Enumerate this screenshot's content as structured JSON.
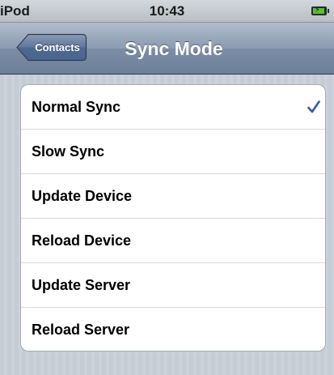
{
  "status_bar": {
    "carrier": "iPod",
    "time": "10:43",
    "battery_icon": "battery-charging-icon"
  },
  "nav_bar": {
    "back_label": "Contacts",
    "title": "Sync Mode"
  },
  "sync_modes": {
    "items": [
      {
        "label": "Normal Sync",
        "selected": true
      },
      {
        "label": "Slow Sync",
        "selected": false
      },
      {
        "label": "Update Device",
        "selected": false
      },
      {
        "label": "Reload Device",
        "selected": false
      },
      {
        "label": "Update Server",
        "selected": false
      },
      {
        "label": "Reload Server",
        "selected": false
      }
    ],
    "check_icon": "checkmark-icon"
  },
  "colors": {
    "nav_bar": "#6d7f99",
    "checkmark": "#3b5998",
    "battery_charge": "#55c233",
    "background": "#c5ccd4"
  }
}
